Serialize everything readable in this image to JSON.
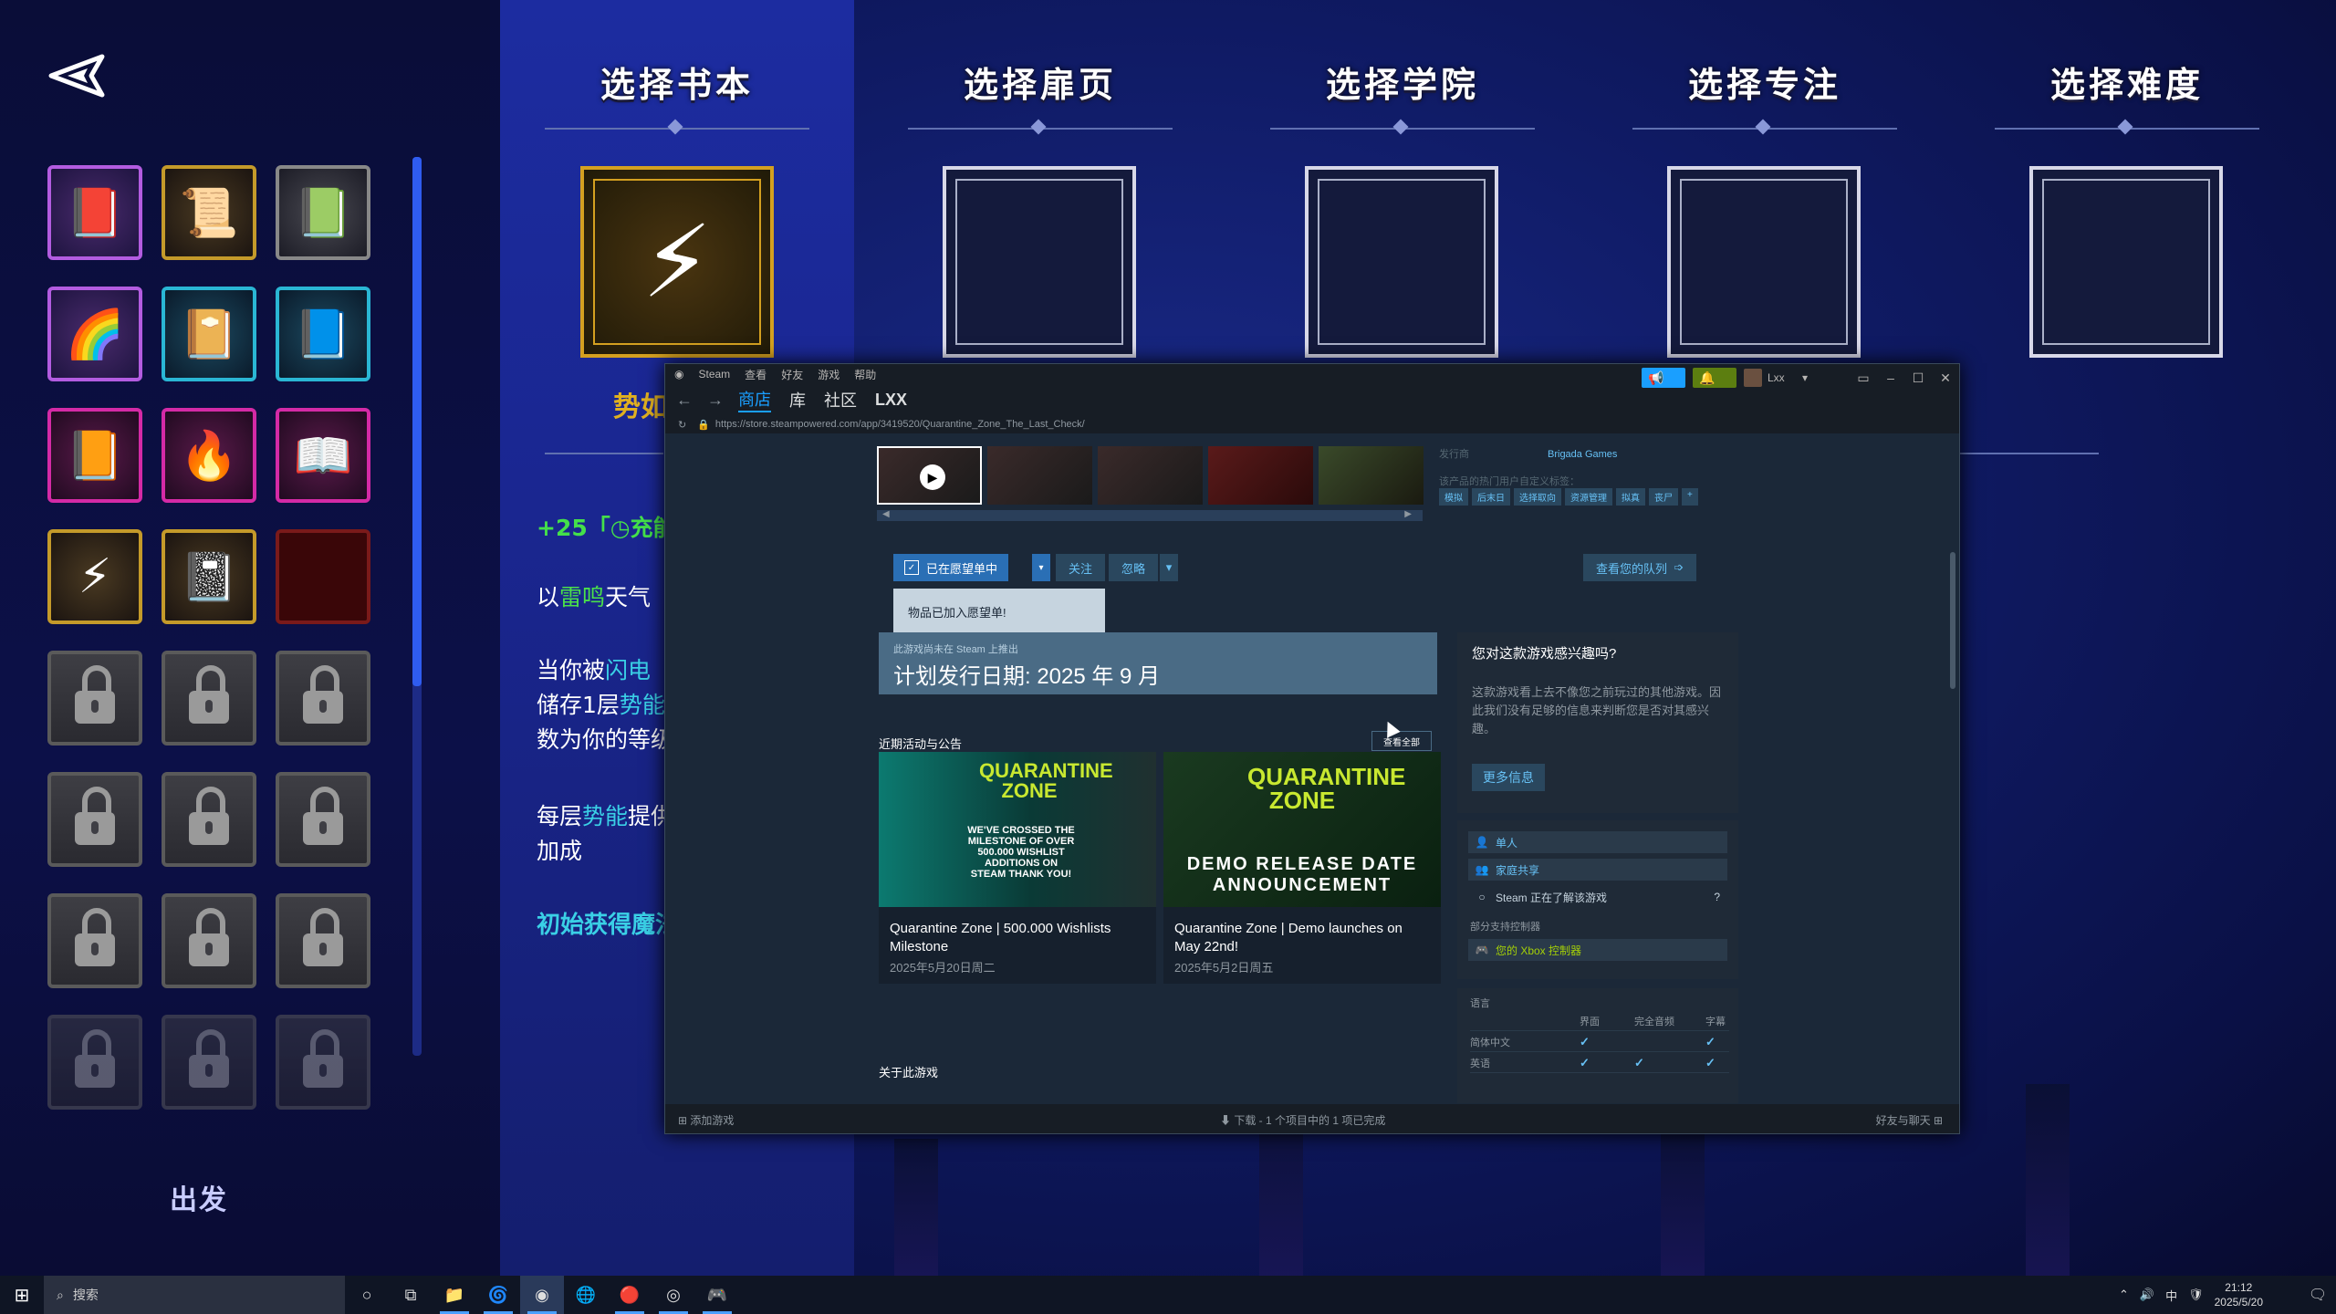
{
  "game": {
    "columns": [
      {
        "title": "选择书本"
      },
      {
        "title": "选择扉页"
      },
      {
        "title": "选择学院"
      },
      {
        "title": "选择专注"
      },
      {
        "title": "选择难度"
      }
    ],
    "selected_name": "势如",
    "desc_line1_prefix": "+25「",
    "desc_line1_icon": "◷",
    "desc_line1_rest": "充能",
    "desc_line2_a": "以",
    "desc_line2_hl": "雷鸣",
    "desc_line2_b": "天气",
    "desc_line3_a": "当你被",
    "desc_line3_hl": "闪电",
    "desc_line4_a": "储存1层",
    "desc_line4_hl": "势能",
    "desc_line5": "数为你的等级",
    "desc_line6_a": "每层",
    "desc_line6_hl": "势能",
    "desc_line6_b": "提供",
    "desc_line7": "加成",
    "desc_line8": "初始获得魔法",
    "go_label": "出发"
  },
  "steam": {
    "menu": [
      "Steam",
      "查看",
      "好友",
      "游戏",
      "帮助"
    ],
    "user": "Lxx",
    "nav_tabs": [
      "商店",
      "库",
      "社区",
      "LXX"
    ],
    "url": "https://store.steampowered.com/app/3419520/Quarantine_Zone_The_Last_Check/",
    "publisher_label": "发行商",
    "publisher": "Brigada Games",
    "tags_label": "该产品的热门用户自定义标签：",
    "tags": [
      "模拟",
      "后末日",
      "选择取向",
      "资源管理",
      "拟真",
      "丧尸",
      "+"
    ],
    "wishlist_label": "已在愿望单中",
    "follow_label": "关注",
    "ignore_label": "忽略",
    "queue_label": "查看您的队列",
    "tooltip": "物品已加入愿望单!",
    "release_note": "此游戏尚未在 Steam 上推出",
    "release_date": "计划发行日期: 2025 年 9 月",
    "recent_title": "近期活动与公告",
    "view_all": "查看全部",
    "news": [
      {
        "title": "Quarantine Zone | 500.000 Wishlists Milestone",
        "date": "2025年5月20日周二",
        "logo": "QUARANTINE ZONE",
        "overlay": "WE'VE CROSSED THE MILESTONE OF OVER 500.000 WISHLIST ADDITIONS ON STEAM THANK YOU!"
      },
      {
        "title": "Quarantine Zone | Demo launches on May 22nd!",
        "date": "2025年5月2日周五",
        "logo": "QUARANTINE ZONE",
        "overlay": "DEMO RELEASE DATE ANNOUNCEMENT"
      }
    ],
    "about_title": "关于此游戏",
    "interest_q": "您对这款游戏感兴趣吗?",
    "interest_text": "这款游戏看上去不像您之前玩过的其他游戏。因此我们没有足够的信息来判断您是否对其感兴趣。",
    "more_info": "更多信息",
    "features": [
      "单人",
      "家庭共享",
      "Steam 正在了解该游戏"
    ],
    "controller_label": "部分支持控制器",
    "controller": "您的 Xbox 控制器",
    "lang_label": "语言",
    "lang_headers": [
      "界面",
      "完全音频",
      "字幕"
    ],
    "languages": [
      {
        "name": "简体中文",
        "ui": "✓",
        "audio": "",
        "sub": "✓"
      },
      {
        "name": "英语",
        "ui": "✓",
        "audio": "✓",
        "sub": "✓"
      }
    ],
    "footer_add": "添加游戏",
    "footer_dl": "下载 - 1 个项目中的 1 项已完成",
    "footer_friends": "好友与聊天"
  },
  "taskbar": {
    "search": "搜索",
    "ime": "中",
    "time": "21:12",
    "date": "2025/5/20"
  }
}
